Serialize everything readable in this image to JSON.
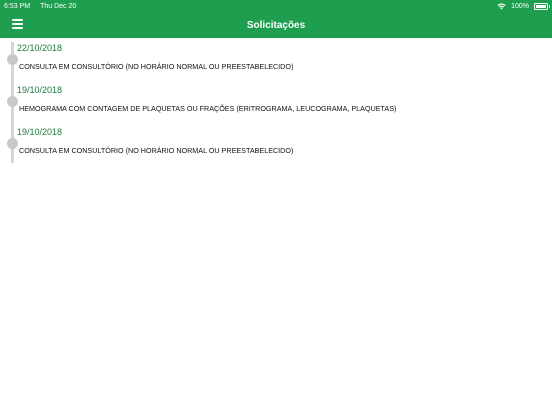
{
  "status_bar": {
    "time": "6:53 PM",
    "date": "Thu Dec 20",
    "battery": "100%"
  },
  "nav": {
    "title": "Solicitações",
    "menu_icon": "hamburger-menu-icon"
  },
  "colors": {
    "brand": "#1e9e4f",
    "date_text": "#1b7a3e"
  },
  "entries": [
    {
      "date": "22/10/2018",
      "description": "CONSULTA EM CONSULTÓRIO (NO HORÁRIO NORMAL OU PREESTABELECIDO)"
    },
    {
      "date": "19/10/2018",
      "description": "HEMOGRAMA COM CONTAGEM DE PLAQUETAS OU FRAÇÕES (ERITROGRAMA, LEUCOGRAMA, PLAQUETAS)"
    },
    {
      "date": "19/10/2018",
      "description": "CONSULTA EM CONSULTÓRIO (NO HORÁRIO NORMAL OU PREESTABELECIDO)"
    }
  ]
}
